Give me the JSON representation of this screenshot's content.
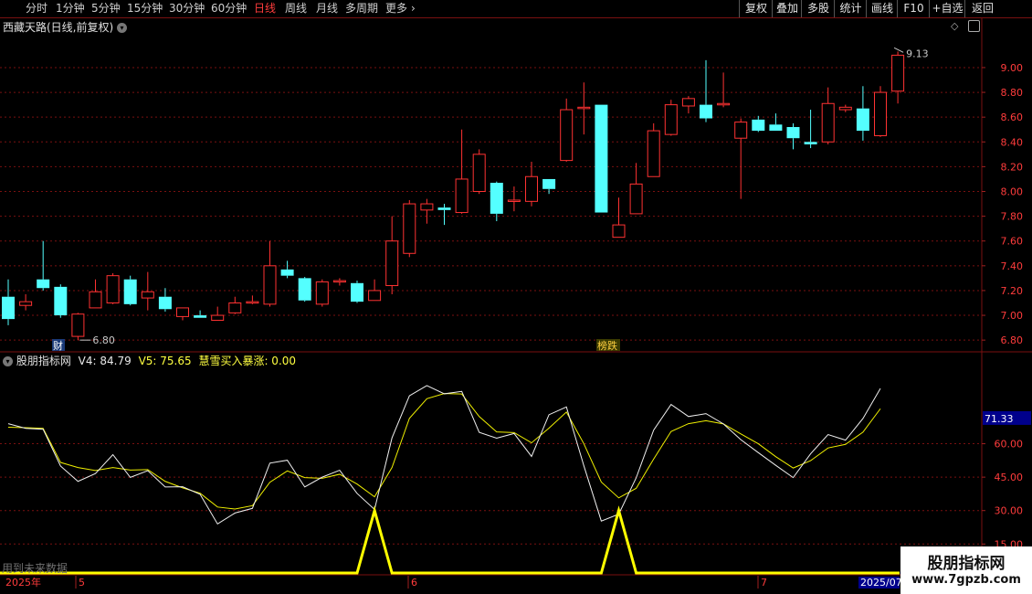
{
  "toolbar": {
    "periods": [
      "分时",
      "1分钟",
      "5分钟",
      "15分钟",
      "30分钟",
      "60分钟",
      "日线",
      "周线",
      "月线",
      "多周期",
      "更多"
    ],
    "active_period": "日线",
    "right_buttons": [
      "复权",
      "叠加",
      "多股",
      "统计",
      "画线",
      "F10",
      "+自选",
      "返回"
    ]
  },
  "stock": {
    "title": "西藏天路(日线,前复权)",
    "high_label": "9.13",
    "low_label": "6.80",
    "marker_cai": "财",
    "marker_bang": "榜跌"
  },
  "price_axis": [
    "9.00",
    "8.80",
    "8.60",
    "8.40",
    "8.20",
    "8.00",
    "7.80",
    "7.60",
    "7.40",
    "7.20",
    "7.00",
    "6.80"
  ],
  "indicator": {
    "name": "股朋指标网",
    "v4_label": "V4: 84.79",
    "v5_label": "V5: 75.65",
    "signal_label": "慧雪买入暴涨: 0.00",
    "current_value": "71.33",
    "axis": [
      "60.00",
      "45.00",
      "30.00",
      "15.00"
    ],
    "footnote": "用到未来数据"
  },
  "date_axis": {
    "year_label": "2025年",
    "months": [
      "5",
      "6",
      "7"
    ],
    "end_label": "2025/07"
  },
  "watermark": {
    "line1": "股朋指标网",
    "line2": "www.7gpzb.com"
  },
  "colors": {
    "up": "#ff3232",
    "down": "#54ffff",
    "grid": "#7a1010",
    "signal": "#ffff00"
  },
  "chart_data": {
    "type": "candlestick",
    "candles": [
      [
        7.15,
        7.29,
        6.92,
        6.97
      ],
      [
        7.08,
        7.17,
        7.04,
        7.11
      ],
      [
        7.29,
        7.6,
        7.2,
        7.22
      ],
      [
        7.23,
        7.25,
        6.98,
        7.0
      ],
      [
        6.83,
        7.02,
        6.8,
        7.01
      ],
      [
        7.06,
        7.29,
        7.06,
        7.19
      ],
      [
        7.1,
        7.34,
        7.09,
        7.32
      ],
      [
        7.29,
        7.32,
        7.08,
        7.09
      ],
      [
        7.14,
        7.35,
        7.04,
        7.19
      ],
      [
        7.15,
        7.22,
        7.03,
        7.05
      ],
      [
        6.99,
        7.05,
        6.96,
        7.06
      ],
      [
        7.0,
        7.04,
        6.98,
        6.98
      ],
      [
        6.96,
        7.07,
        6.96,
        7.0
      ],
      [
        7.02,
        7.15,
        7.01,
        7.1
      ],
      [
        7.1,
        7.16,
        7.09,
        7.11
      ],
      [
        7.09,
        7.6,
        7.07,
        7.4
      ],
      [
        7.37,
        7.44,
        7.3,
        7.32
      ],
      [
        7.3,
        7.31,
        7.11,
        7.12
      ],
      [
        7.09,
        7.29,
        7.07,
        7.27
      ],
      [
        7.27,
        7.3,
        7.24,
        7.28
      ],
      [
        7.26,
        7.28,
        7.1,
        7.11
      ],
      [
        7.12,
        7.29,
        7.12,
        7.2
      ],
      [
        7.24,
        7.8,
        7.17,
        7.6
      ],
      [
        7.5,
        7.93,
        7.47,
        7.9
      ],
      [
        7.85,
        7.94,
        7.74,
        7.9
      ],
      [
        7.87,
        7.9,
        7.73,
        7.85
      ],
      [
        7.83,
        8.5,
        7.82,
        8.1
      ],
      [
        8.0,
        8.34,
        7.98,
        8.3
      ],
      [
        8.07,
        8.08,
        7.76,
        7.82
      ],
      [
        7.93,
        8.04,
        7.84,
        7.93
      ],
      [
        7.92,
        8.24,
        7.88,
        8.12
      ],
      [
        8.1,
        8.1,
        7.98,
        8.02
      ],
      [
        8.25,
        8.75,
        8.24,
        8.66
      ],
      [
        8.68,
        8.88,
        8.46,
        8.68
      ],
      [
        8.7,
        8.7,
        7.83,
        7.83
      ],
      [
        7.63,
        7.95,
        7.64,
        7.73
      ],
      [
        7.82,
        8.23,
        7.82,
        8.06
      ],
      [
        8.12,
        8.55,
        8.12,
        8.49
      ],
      [
        8.46,
        8.74,
        8.45,
        8.7
      ],
      [
        8.69,
        8.77,
        8.63,
        8.75
      ],
      [
        8.7,
        9.06,
        8.56,
        8.59
      ],
      [
        8.71,
        8.96,
        8.68,
        8.71
      ],
      [
        8.43,
        8.59,
        7.94,
        8.56
      ],
      [
        8.58,
        8.61,
        8.48,
        8.49
      ],
      [
        8.54,
        8.63,
        8.49,
        8.49
      ],
      [
        8.52,
        8.55,
        8.34,
        8.43
      ],
      [
        8.4,
        8.66,
        8.35,
        8.38
      ],
      [
        8.4,
        8.84,
        8.38,
        8.71
      ],
      [
        8.66,
        8.7,
        8.64,
        8.68
      ],
      [
        8.67,
        8.85,
        8.41,
        8.49
      ],
      [
        8.45,
        8.85,
        8.44,
        8.8
      ],
      [
        8.81,
        9.13,
        8.71,
        9.1
      ]
    ],
    "v4": [
      69.0,
      66.9,
      66.5,
      50.0,
      43.1,
      46.6,
      55.1,
      44.9,
      47.9,
      40.6,
      40.7,
      37.3,
      24.0,
      28.9,
      31.0,
      51.3,
      52.6,
      40.6,
      45.0,
      48.1,
      37.7,
      30.5,
      62.6,
      81.5,
      86.1,
      82.4,
      83.5,
      65.1,
      62.5,
      64.6,
      54.3,
      73.0,
      76.5,
      50.1,
      25.3,
      28.4,
      44.7,
      66.1,
      77.6,
      72.2,
      73.5,
      68.9,
      61.8,
      56.0,
      50.3,
      44.8,
      55.5,
      64.1,
      61.6,
      71.3,
      84.8
    ],
    "v5": [
      67.4,
      67.2,
      66.9,
      51.6,
      49.3,
      48.0,
      49.3,
      48.2,
      48.4,
      43.1,
      40.2,
      37.8,
      31.6,
      30.7,
      32.2,
      42.7,
      47.8,
      44.8,
      44.5,
      46.3,
      41.9,
      36.2,
      49.3,
      71.4,
      80.2,
      82.5,
      82.3,
      72.2,
      65.3,
      65.0,
      60.4,
      67.0,
      74.2,
      60.0,
      42.8,
      35.7,
      40.0,
      53.1,
      65.5,
      69.0,
      70.3,
      68.9,
      64.4,
      60.0,
      54.2,
      49.1,
      52.4,
      58.1,
      59.7,
      65.2,
      75.7
    ],
    "signal": [
      0,
      0,
      0,
      0,
      0,
      0,
      0,
      0,
      0,
      0,
      0,
      0,
      0,
      0,
      0,
      0,
      0,
      0,
      0,
      0,
      0,
      30,
      0,
      0,
      0,
      0,
      0,
      0,
      0,
      0,
      0,
      0,
      0,
      0,
      0,
      30,
      0,
      0,
      0,
      0,
      0,
      0,
      0,
      0,
      0,
      0,
      0,
      0,
      0,
      0,
      0
    ],
    "price_range": [
      6.72,
      9.28
    ],
    "indicator_range": [
      2,
      100
    ]
  }
}
